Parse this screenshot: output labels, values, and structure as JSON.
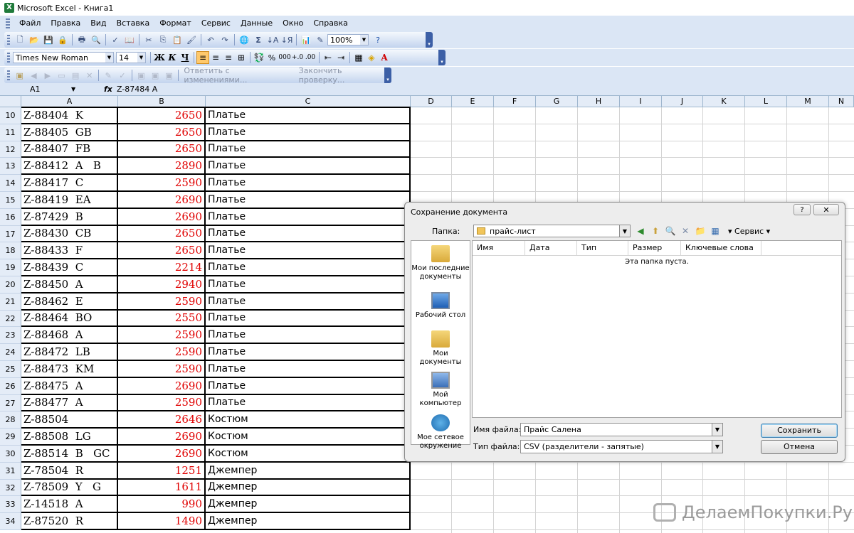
{
  "window": {
    "title": "Microsoft Excel - Книга1"
  },
  "menu": [
    "Файл",
    "Правка",
    "Вид",
    "Вставка",
    "Формат",
    "Сервис",
    "Данные",
    "Окно",
    "Справка"
  ],
  "toolbar": {
    "zoom": "100%"
  },
  "format_toolbar": {
    "font": "Times New Roman",
    "size": "14",
    "bold": "Ж",
    "italic": "К",
    "underline": "Ч",
    "percent": "%",
    "thousands": "000"
  },
  "review_toolbar": {
    "reply": "Ответить с изменениями...",
    "end_review": "Закончить проверку..."
  },
  "formula_bar": {
    "name_box": "A1",
    "fx": "fx",
    "value": "Z-87484  A"
  },
  "columns": [
    "A",
    "B",
    "C",
    "D",
    "E",
    "F",
    "G",
    "H",
    "I",
    "J",
    "K",
    "L",
    "M",
    "N"
  ],
  "rows": [
    {
      "n": "10",
      "a": "Z-88404  K",
      "b": "2650",
      "c": "Платье"
    },
    {
      "n": "11",
      "a": "Z-88405  GB",
      "b": "2650",
      "c": "Платье"
    },
    {
      "n": "12",
      "a": "Z-88407  FB",
      "b": "2650",
      "c": "Платье"
    },
    {
      "n": "13",
      "a": "Z-88412  A   B",
      "b": "2890",
      "c": "Платье"
    },
    {
      "n": "14",
      "a": "Z-88417  C",
      "b": "2590",
      "c": "Платье"
    },
    {
      "n": "15",
      "a": "Z-88419  EA",
      "b": "2690",
      "c": "Платье"
    },
    {
      "n": "16",
      "a": "Z-87429  B",
      "b": "2690",
      "c": "Платье"
    },
    {
      "n": "17",
      "a": "Z-88430  CB",
      "b": "2650",
      "c": "Платье"
    },
    {
      "n": "18",
      "a": "Z-88433  F",
      "b": "2650",
      "c": "Платье"
    },
    {
      "n": "19",
      "a": "Z-88439  C",
      "b": "2214",
      "c": "Платье"
    },
    {
      "n": "20",
      "a": "Z-88450  A",
      "b": "2940",
      "c": "Платье"
    },
    {
      "n": "21",
      "a": "Z-88462  E",
      "b": "2590",
      "c": "Платье"
    },
    {
      "n": "22",
      "a": "Z-88464  BO",
      "b": "2550",
      "c": "Платье"
    },
    {
      "n": "23",
      "a": "Z-88468  A",
      "b": "2590",
      "c": "Платье"
    },
    {
      "n": "24",
      "a": "Z-88472  LB",
      "b": "2590",
      "c": "Платье"
    },
    {
      "n": "25",
      "a": "Z-88473  KM",
      "b": "2590",
      "c": "Платье"
    },
    {
      "n": "26",
      "a": "Z-88475  A",
      "b": "2690",
      "c": "Платье"
    },
    {
      "n": "27",
      "a": "Z-88477  A",
      "b": "2590",
      "c": "Платье"
    },
    {
      "n": "28",
      "a": "Z-88504",
      "b": "2646",
      "c": "Костюм"
    },
    {
      "n": "29",
      "a": "Z-88508  LG",
      "b": "2690",
      "c": "Костюм"
    },
    {
      "n": "30",
      "a": "Z-88514  B   GC",
      "b": "2690",
      "c": "Костюм"
    },
    {
      "n": "31",
      "a": "Z-78504  R",
      "b": "1251",
      "c": "Джемпер"
    },
    {
      "n": "32",
      "a": "Z-78509  Y   G",
      "b": "1611",
      "c": "Джемпер"
    },
    {
      "n": "33",
      "a": "Z-14518  A",
      "b": "990",
      "c": "Джемпер"
    },
    {
      "n": "34",
      "a": "Z-87520  R",
      "b": "1490",
      "c": "Джемпер"
    }
  ],
  "dialog": {
    "title": "Сохранение документа",
    "help": "?",
    "close": "✕",
    "folder_label": "Папка:",
    "folder": "прайс-лист",
    "service": "Сервис",
    "places": [
      "Мои последние документы",
      "Рабочий стол",
      "Мои документы",
      "Мой компьютер",
      "Мое сетевое окружение"
    ],
    "list_columns": [
      "Имя",
      "Дата",
      "Тип",
      "Размер",
      "Ключевые слова"
    ],
    "empty_text": "Эта папка пуста.",
    "filename_label": "Имя файла:",
    "filename": "Прайс Салена",
    "filetype_label": "Тип файла:",
    "filetype": "CSV (разделители - запятые)",
    "save": "Сохранить",
    "cancel": "Отмена"
  },
  "watermark": "ДелаемПокупки.Ру",
  "colors": {
    "price_red": "#e00000",
    "toolbar_bg": "#dbe6f5",
    "header_bg": "#e4ecf7",
    "grid": "#d4d4d4"
  }
}
